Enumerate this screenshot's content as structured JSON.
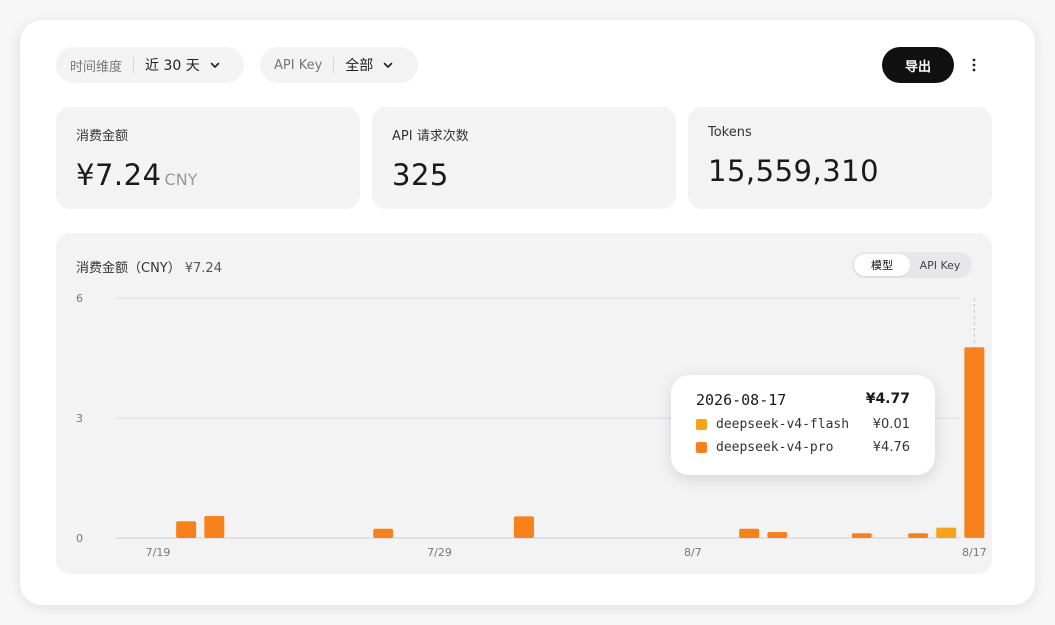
{
  "filters": {
    "time": {
      "label": "时间维度",
      "value": "近 30 天"
    },
    "api_key": {
      "label": "API Key",
      "value": "全部"
    }
  },
  "actions": {
    "export_label": "导出"
  },
  "stats": {
    "cost": {
      "label": "消费金额",
      "value": "¥7.24",
      "unit": "CNY"
    },
    "requests": {
      "label": "API 请求次数",
      "value": "325"
    },
    "tokens": {
      "label": "Tokens",
      "value": "15,559,310"
    }
  },
  "chart_panel": {
    "title": "消费金额（CNY）",
    "total": "¥7.24",
    "toggle": {
      "model": "模型",
      "api_key": "API Key"
    }
  },
  "colors": {
    "flash": "#f5a31a",
    "pro": "#f7821b",
    "accent": "#111111"
  },
  "tooltip": {
    "date": "2026-08-17",
    "total": "¥4.77",
    "rows": [
      {
        "name": "deepseek-v4-flash",
        "value": "¥0.01"
      },
      {
        "name": "deepseek-v4-pro",
        "value": "¥4.76"
      }
    ]
  },
  "chart_data": {
    "type": "bar",
    "stacked": true,
    "categories": [
      "7/19",
      "7/20",
      "7/21",
      "7/22",
      "7/23",
      "7/24",
      "7/25",
      "7/26",
      "7/27",
      "7/28",
      "7/29",
      "7/30",
      "7/31",
      "8/1",
      "8/2",
      "8/3",
      "8/4",
      "8/5",
      "8/6",
      "8/7",
      "8/8",
      "8/9",
      "8/10",
      "8/11",
      "8/12",
      "8/13",
      "8/14",
      "8/15",
      "8/16",
      "8/17"
    ],
    "tick_labels": [
      "7/19",
      "7/29",
      "8/7",
      "8/17"
    ],
    "yticks": [
      0,
      3,
      6
    ],
    "ylim": [
      0,
      6
    ],
    "series": [
      {
        "name": "deepseek-v4-flash",
        "values": [
          0,
          0,
          0,
          0,
          0,
          0,
          0,
          0,
          0,
          0,
          0,
          0,
          0,
          0,
          0,
          0,
          0,
          0,
          0,
          0,
          0,
          0,
          0,
          0,
          0,
          0,
          0,
          0,
          0.26,
          0.01
        ]
      },
      {
        "name": "deepseek-v4-pro",
        "values": [
          0,
          0.42,
          0.55,
          0,
          0,
          0,
          0,
          0,
          0.23,
          0,
          0,
          0,
          0,
          0.54,
          0,
          0,
          0,
          0,
          0,
          0,
          0,
          0.23,
          0.15,
          0,
          0,
          0.12,
          0,
          0.12,
          0,
          4.76
        ]
      }
    ],
    "highlight": "8/17"
  }
}
